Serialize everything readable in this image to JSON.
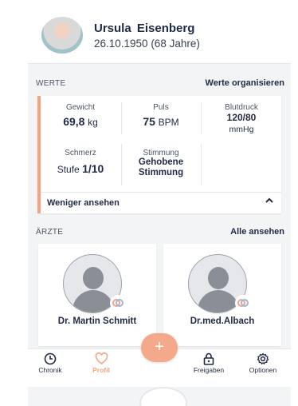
{
  "profile": {
    "name": "Ursula  Eisenberg",
    "dob": "26.10.1950 (68 Jahre)"
  },
  "werte": {
    "title": "WERTE",
    "organize_link": "Werte organisieren",
    "items": [
      {
        "label": "Gewicht",
        "value": "69,8",
        "unit": "kg"
      },
      {
        "label": "Puls",
        "value": "75",
        "unit": "BPM"
      },
      {
        "label": "Blutdruck",
        "value": "120/80",
        "unit": "mmHg"
      },
      {
        "label": "Schmerz",
        "prefix": "Stufe",
        "value": "1/10"
      },
      {
        "label": "Stimmung",
        "value": "Gehobene",
        "value2": "Stimmung"
      }
    ],
    "less_label": "Weniger ansehen",
    "less_icon": "chevron-up-icon"
  },
  "aerzte": {
    "title": "ÄRZTE",
    "all_link": "Alle ansehen",
    "doctors": [
      {
        "name": "Dr. Martin Schmitt"
      },
      {
        "name": "Dr.med.Albach"
      }
    ]
  },
  "fab": {
    "label": "+"
  },
  "nav": {
    "items": [
      {
        "label": "Chronik",
        "icon": "clock-icon"
      },
      {
        "label": "Profil",
        "icon": "heart-icon"
      },
      {
        "label": "Freigaben",
        "icon": "lock-icon"
      },
      {
        "label": "Optionen",
        "icon": "gear-icon"
      }
    ]
  },
  "colors": {
    "accent": "#f2a582",
    "text": "#1f2a44",
    "background": "#f3f4f6"
  }
}
